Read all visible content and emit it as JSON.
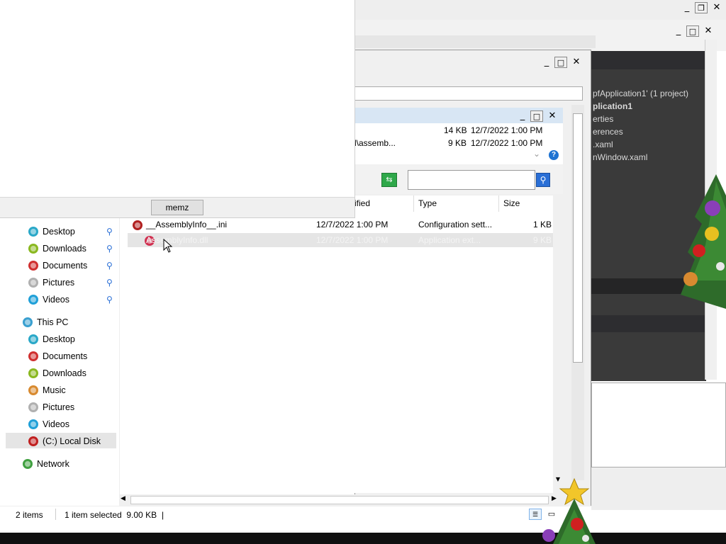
{
  "popup": {
    "button_label": "memz"
  },
  "explorer": {
    "recent_rows": [
      {
        "name": "l\\assemb...",
        "size": "14 KB",
        "modified": "12/7/2022 1:00 PM"
      },
      {
        "name": "l\\assemb...",
        "size": "9 KB",
        "modified": "12/7/2022 1:00 PM"
      }
    ],
    "columns": {
      "modified": "ified",
      "type": "Type",
      "size": "Size"
    },
    "files": [
      {
        "name": "__AssemblyInfo__.ini",
        "modified": "12/7/2022 1:00 PM",
        "type": "Configuration sett...",
        "size": "1 KB"
      },
      {
        "name": "AssemblyInfo.dll",
        "modified": "12/7/2022 1:00 PM",
        "type": "Application ext...",
        "size": "9 KB"
      }
    ],
    "quick_access": [
      {
        "label": "Desktop",
        "color": "#2aa8c8"
      },
      {
        "label": "Downloads",
        "color": "#8ab820"
      },
      {
        "label": "Documents",
        "color": "#d03030"
      },
      {
        "label": "Pictures",
        "color": "#b0b0b0"
      },
      {
        "label": "Videos",
        "color": "#20a0d8"
      }
    ],
    "this_pc": {
      "label": "This PC",
      "items": [
        {
          "label": "Desktop",
          "color": "#2aa8c8"
        },
        {
          "label": "Documents",
          "color": "#d03030"
        },
        {
          "label": "Downloads",
          "color": "#8ab820"
        },
        {
          "label": "Music",
          "color": "#d88a30"
        },
        {
          "label": "Pictures",
          "color": "#b0b0b0"
        },
        {
          "label": "Videos",
          "color": "#20a0d8"
        },
        {
          "label": "(C:) Local Disk",
          "color": "#c02020"
        }
      ]
    },
    "network": "Network",
    "status": {
      "items": "2 items",
      "selected": "1 item selected  9.00 KB",
      "cursor": "|"
    }
  },
  "vs": {
    "lines": [
      "pfApplication1' (1 project)",
      "plication1",
      "erties",
      "erences",
      ".xaml",
      "nWindow.xaml"
    ]
  },
  "colors": {
    "selection": "#e5e5e5",
    "vs_dark": "#3a3a3a",
    "accent": "#2a6fd6"
  }
}
